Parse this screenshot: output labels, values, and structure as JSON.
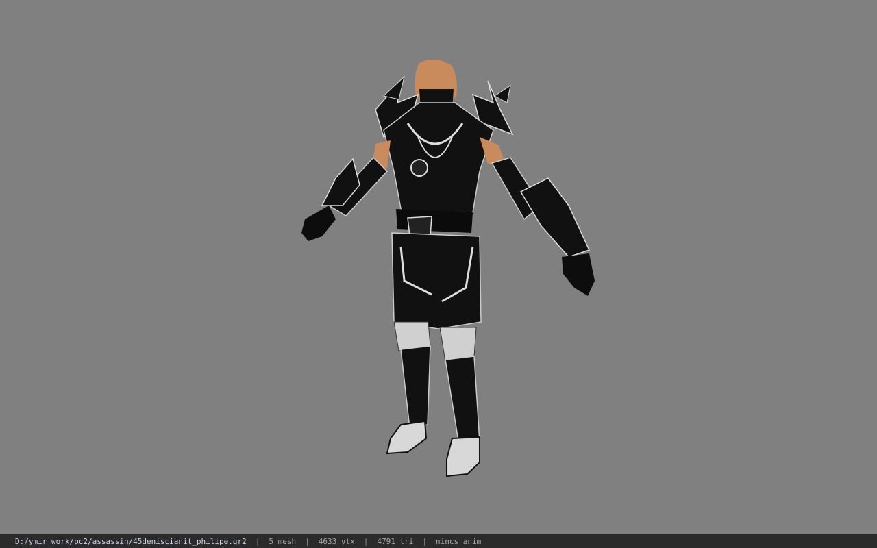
{
  "viewer": {
    "background_color": "#808080",
    "model_icon": "character-model",
    "colors": {
      "armor": "#111111",
      "trim": "#d9d9d9",
      "skin": "#c98a5c"
    }
  },
  "status": {
    "file_path": "D:/ymir work/pc2/assassin/45deniscianit_philipe.gr2",
    "separator": "|",
    "mesh_count": "5 mesh",
    "vertex_count": "4633 vtx",
    "triangle_count": "4791 tri",
    "animation": "nincs anim"
  }
}
